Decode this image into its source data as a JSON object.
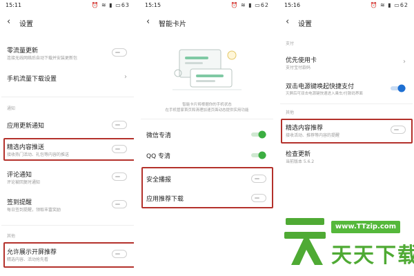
{
  "colors": {
    "accent_blue": "#1e6fd2",
    "toggle_green": "#3cae42",
    "highlight_red": "#b3302a",
    "watermark_green": "#4faa34"
  },
  "panel1": {
    "status": {
      "time": "15:11",
      "battery": "63"
    },
    "title": "设置",
    "items": [
      {
        "title": "零流量更新",
        "subtitle": "连接无线网络后自动下载并安装更新包"
      },
      {
        "title": "手机流量下载设置"
      }
    ],
    "section_notify": "通知",
    "notify_items": [
      {
        "title": "应用更新通知"
      },
      {
        "title": "精选内容推送",
        "subtitle": "接收热门活动、礼包等内容的推送"
      },
      {
        "title": "评论通知",
        "subtitle": "评论被回复时通知"
      },
      {
        "title": "签到提醒",
        "subtitle": "每日签到提醒，领取丰富奖励"
      }
    ],
    "section_other": "其他",
    "other_items": [
      {
        "title": "允许展示开屏推荐",
        "subtitle": "精选内容、活动抢先看"
      }
    ]
  },
  "panel2": {
    "status": {
      "time": "15:15",
      "battery": "62"
    },
    "title": "智能卡片",
    "intro_line1": "智能卡片将根据你的手机状态",
    "intro_line2": "在手机管家首页和清理加速页面动态提供实用功能",
    "items": [
      {
        "title": "微信专清",
        "on": true
      },
      {
        "title": "QQ 专清",
        "on": true
      },
      {
        "title": "安全播报",
        "on": false
      },
      {
        "title": "应用推荐下载",
        "on": false
      }
    ]
  },
  "panel3": {
    "status": {
      "time": "15:16",
      "battery": "62"
    },
    "title": "设置",
    "section_pay": "支付",
    "pay_items": [
      {
        "title": "优先使用卡",
        "subtitle": "支付宝付款码"
      },
      {
        "title": "双击电源键唤起快捷支付",
        "subtitle": "灭屏后可双击电源键快速进入乘车/付款码界面"
      }
    ],
    "section_other": "其他",
    "other_items": [
      {
        "title": "精选内容推荐",
        "subtitle": "接收活动、推荐等内容的提醒"
      },
      {
        "title": "检查更新",
        "subtitle": "当前版本 5.6.2"
      }
    ]
  },
  "watermark": {
    "url": "www.TTzip.com",
    "text": "天天下载"
  }
}
